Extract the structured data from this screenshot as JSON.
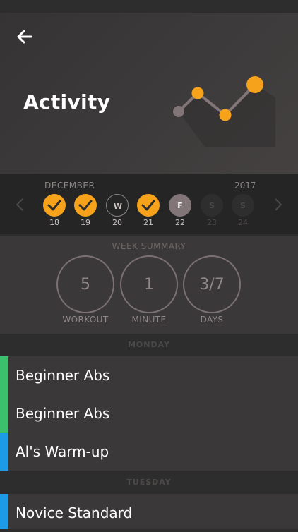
{
  "header": {
    "title": "Activity"
  },
  "calendar": {
    "month": "DECEMBER",
    "year": "2017",
    "days": [
      {
        "letter": "",
        "num": "18",
        "state": "done"
      },
      {
        "letter": "",
        "num": "19",
        "state": "done"
      },
      {
        "letter": "W",
        "num": "20",
        "state": "outline"
      },
      {
        "letter": "",
        "num": "21",
        "state": "done"
      },
      {
        "letter": "F",
        "num": "22",
        "state": "today"
      },
      {
        "letter": "S",
        "num": "23",
        "state": "future"
      },
      {
        "letter": "S",
        "num": "24",
        "state": "future"
      }
    ]
  },
  "summary": {
    "label": "WEEK SUMMARY",
    "stats": [
      {
        "value": "5",
        "label": "WORKOUT"
      },
      {
        "value": "1",
        "label": "MINUTE"
      },
      {
        "value": "3/7",
        "label": "DAYS"
      }
    ]
  },
  "schedule": {
    "monday": {
      "heading": "MONDAY",
      "items": [
        {
          "name": "Beginner Abs",
          "color": "#3cc06c"
        },
        {
          "name": "Beginner Abs",
          "color": "#3cc06c"
        },
        {
          "name": "Al's Warm-up",
          "color": "#1e9be6"
        }
      ]
    },
    "tuesday": {
      "heading": "TUESDAY",
      "items": [
        {
          "name": "Novice Standard",
          "color": "#1e9be6"
        }
      ]
    }
  },
  "colors": {
    "accent": "#f7a21b",
    "today": "#817578"
  }
}
